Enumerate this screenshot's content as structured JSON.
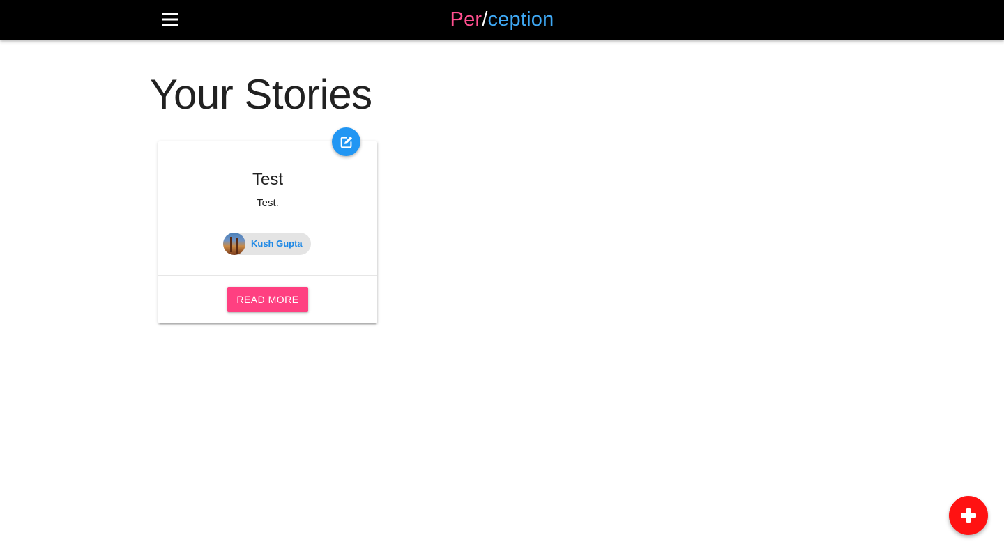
{
  "navbar": {
    "menu_icon": "hamburger-menu-icon",
    "brand": {
      "part1": "Per",
      "part2": "/",
      "part3": "ception"
    },
    "colors": {
      "background": "#000000",
      "part1": "#ff4f8f",
      "part2": "#ffffff",
      "part3": "#3fa9f5"
    }
  },
  "page": {
    "title": "Your Stories"
  },
  "stories": [
    {
      "title": "Test",
      "text": "Test.",
      "author": "Kush Gupta",
      "author_avatar": "photo-avatar",
      "action_label": "Read More",
      "edit_icon": "edit-icon"
    }
  ],
  "fab": {
    "icon": "plus-icon",
    "color": "#ff1212"
  },
  "colors": {
    "accent_pink": "#ff4081",
    "accent_blue": "#2196f3",
    "chip_text": "#1e88e5"
  }
}
